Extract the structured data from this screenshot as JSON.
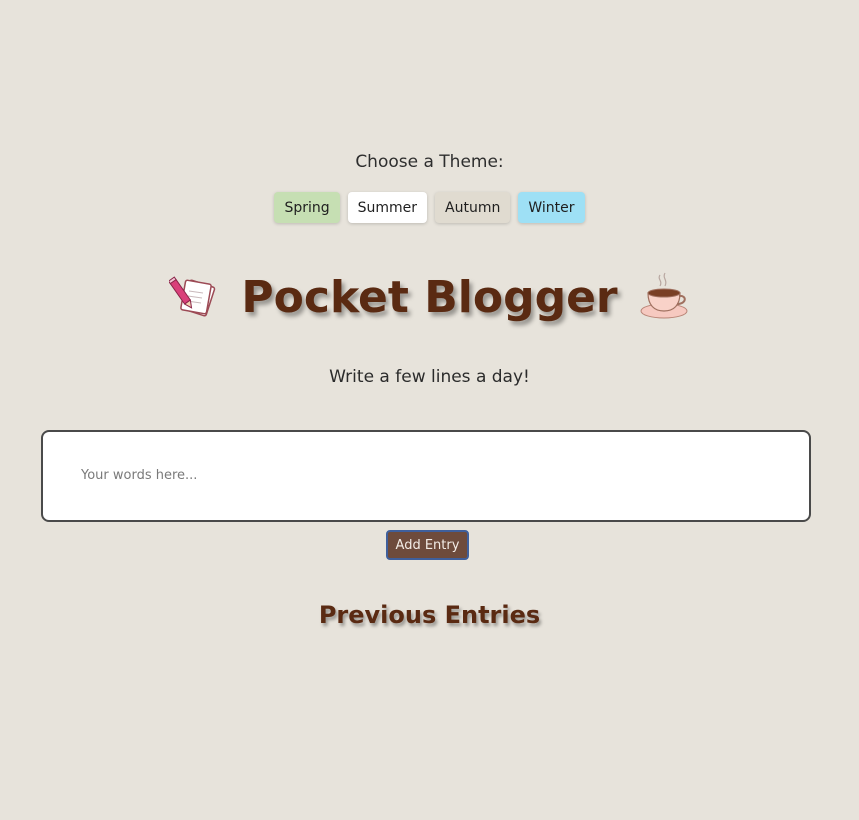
{
  "theme": {
    "label": "Choose a Theme:",
    "buttons": [
      {
        "label": "Spring",
        "color": "#c6dfb3"
      },
      {
        "label": "Summer",
        "color": "#ffffff"
      },
      {
        "label": "Autumn",
        "color": "#e0dbd0"
      },
      {
        "label": "Winter",
        "color": "#9ee0f5"
      }
    ]
  },
  "header": {
    "title": "Pocket Blogger",
    "left_icon": "notepad-pencil-icon",
    "right_icon": "coffee-cup-icon",
    "tagline": "Write a few lines a day!"
  },
  "entry": {
    "placeholder": "Your words here...",
    "value": "",
    "add_label": "Add Entry"
  },
  "previous": {
    "title": "Previous Entries",
    "items": []
  },
  "colors": {
    "background": "#e7e3db",
    "title": "#5a2a12",
    "add_button": "#6e4b3c"
  }
}
